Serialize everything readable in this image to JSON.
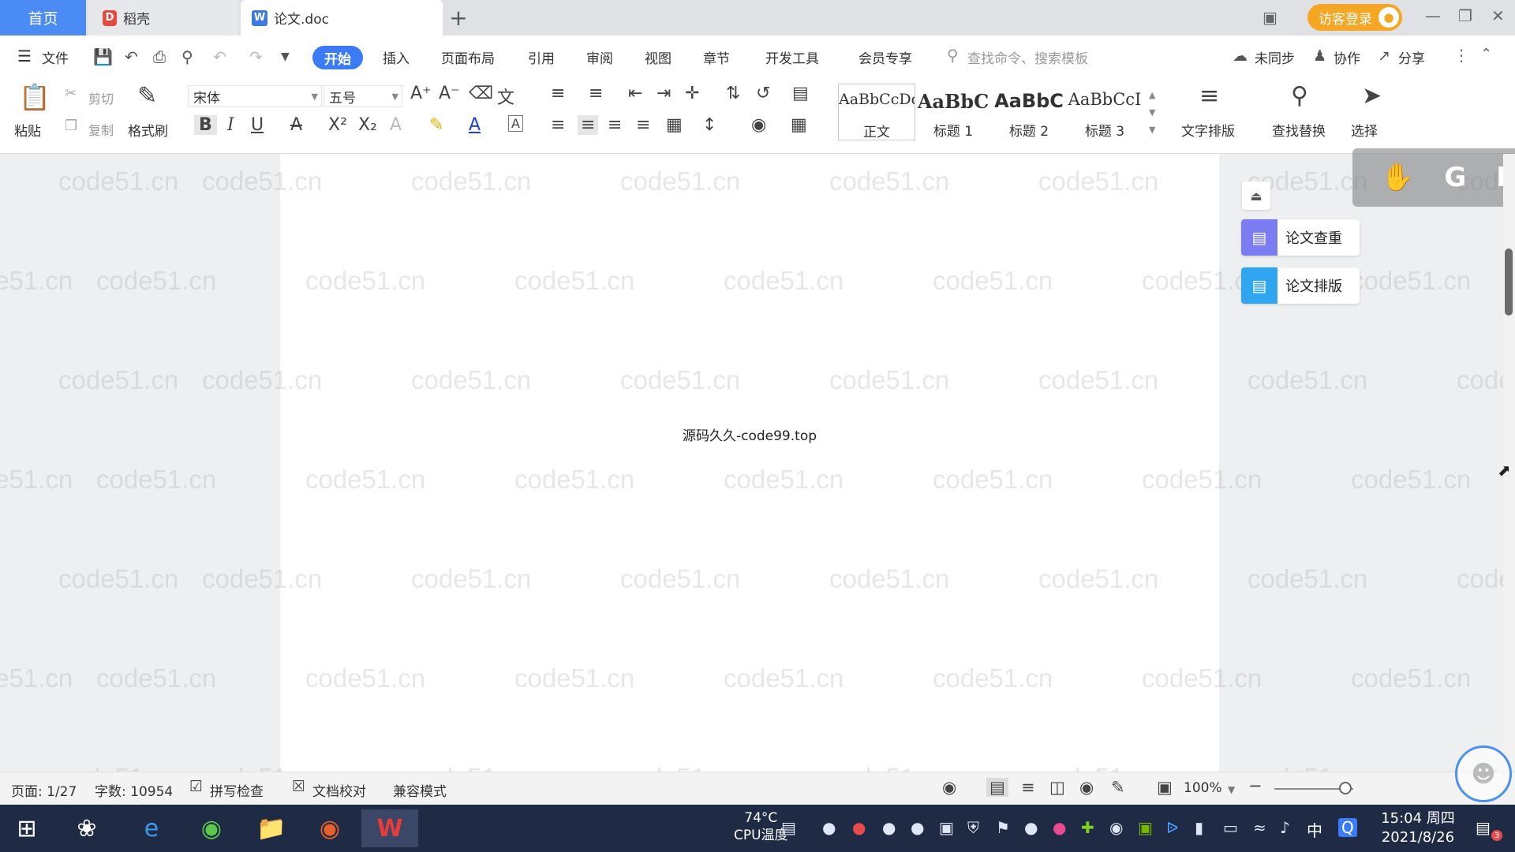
{
  "tabs": {
    "home": "首页",
    "daoke": "稻壳",
    "doc": "论文.doc",
    "add": "+"
  },
  "header": {
    "login": "访客登录",
    "menu_file": "文件",
    "menus": [
      "开始",
      "插入",
      "页面布局",
      "引用",
      "审阅",
      "视图",
      "章节",
      "开发工具",
      "会员专享"
    ],
    "search": "查找命令、搜索模板",
    "unsync": "未同步",
    "collab": "协作",
    "share": "分享"
  },
  "ribbon": {
    "paste": "粘贴",
    "cut": "剪切",
    "copy": "复制",
    "format_painter": "格式刷",
    "font_name": "宋体",
    "font_size": "五号",
    "styles": [
      {
        "preview": "AaBbCcDd",
        "name": "正文"
      },
      {
        "preview": "AaBbC",
        "name": "标题 1"
      },
      {
        "preview": "AaBbC",
        "name": "标题 2"
      },
      {
        "preview": "AaBbCcI",
        "name": "标题 3"
      }
    ],
    "text_layout": "文字排版",
    "find_replace": "查找替换",
    "select": "选择"
  },
  "side_panel": {
    "check": "论文查重",
    "layout": "论文排版",
    "float": [
      "G",
      "F"
    ]
  },
  "document": {
    "text": "源码久久-code99.top",
    "watermark": "code51.cn"
  },
  "status": {
    "page": "页面: 1/27",
    "words": "字数: 10954",
    "spell": "拼写检查",
    "proof": "文档校对",
    "compat": "兼容模式",
    "zoom": "100%",
    "zoom_level": 0.9
  },
  "taskbar": {
    "temp": "74°C",
    "cpu": "CPU温度",
    "ime": "中",
    "time": "15:04 周四",
    "date": "2021/8/26",
    "notif_count": "3"
  },
  "colors": {
    "accent": "#3b7cf6",
    "login": "#f5a623",
    "taskbar": "#1f2a44"
  }
}
